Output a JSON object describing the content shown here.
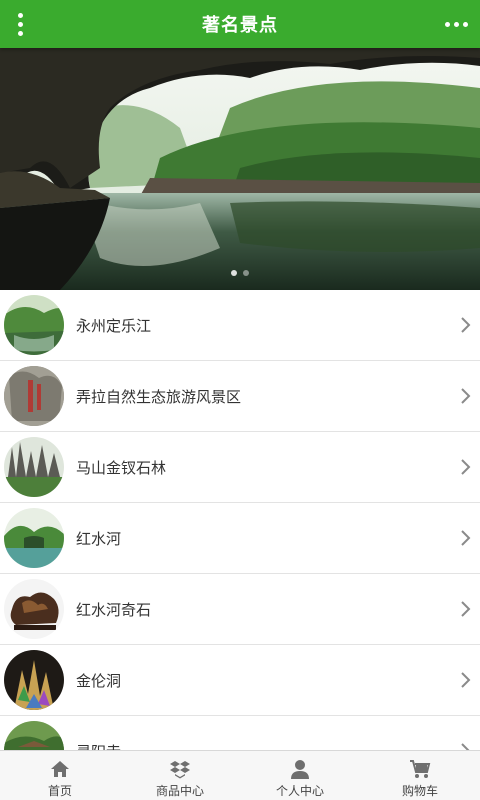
{
  "header": {
    "title": "著名景点",
    "menu_icon": "vertical-dots-icon",
    "more_icon": "horizontal-dots-icon",
    "background": "#3aab2e"
  },
  "banner": {
    "slides": 2,
    "active_slide": 1
  },
  "list": {
    "items": [
      {
        "label": "永州定乐江"
      },
      {
        "label": "弄拉自然生态旅游风景区"
      },
      {
        "label": "马山金钗石林"
      },
      {
        "label": "红水河"
      },
      {
        "label": "红水河奇石"
      },
      {
        "label": "金伦洞"
      },
      {
        "label": "灵阳寺"
      }
    ],
    "chevron_icon": "chevron-right-icon"
  },
  "tabbar": {
    "tabs": [
      {
        "label": "首页",
        "icon": "home-icon"
      },
      {
        "label": "商品中心",
        "icon": "box-icon"
      },
      {
        "label": "个人中心",
        "icon": "user-icon"
      },
      {
        "label": "购物车",
        "icon": "cart-icon"
      }
    ]
  }
}
